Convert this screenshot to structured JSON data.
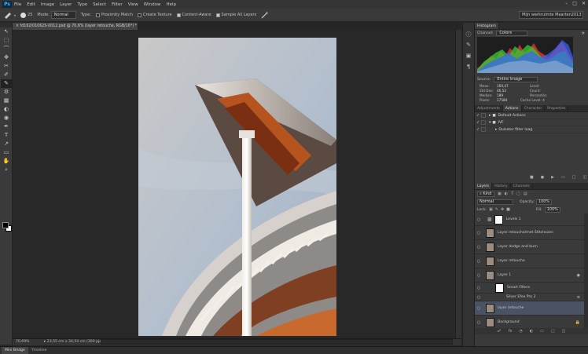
{
  "app": {
    "logo": "Ps"
  },
  "menu": [
    "File",
    "Edit",
    "Image",
    "Layer",
    "Type",
    "Select",
    "Filter",
    "View",
    "Window",
    "Help"
  ],
  "window_controls": [
    "–",
    "□",
    "✕"
  ],
  "options_bar": {
    "brush_size": "25",
    "mode_label": "Mode:",
    "mode_value": "Normal",
    "type_label": "Type:",
    "proximity_match": "Proximity Match",
    "create_texture": "Create Texture",
    "content_aware": "Content-Aware",
    "sample_all_layers": "Sample All Layers",
    "workspace": "Mijn werkruimte Maarten2013"
  },
  "document": {
    "tab_title": "× fd162/01062S-0012.psd @ 70,6% (layer retouche, RGB/16*) *",
    "zoom": "70,69%",
    "doc_info": "▸ 23,55 cm x 34,54 cm (300 ppi)"
  },
  "bottom_tabs": [
    "Mini Bridge",
    "Timeline"
  ],
  "histogram": {
    "tab": "Histogram",
    "channel_label": "Channel:",
    "channel_value": "Colors",
    "source_label": "Source:",
    "source_value": "Entire Image",
    "stats": [
      {
        "k": "Mean:",
        "v": "160,47"
      },
      {
        "k": "Std Dev:",
        "v": "46,52"
      },
      {
        "k": "Median:",
        "v": "189"
      },
      {
        "k": "Pixels:",
        "v": "17584"
      }
    ],
    "stats_right": [
      "Level:",
      "Count:",
      "Percentile:",
      "Cache Level: 4"
    ]
  },
  "actions_panel": {
    "tabs": [
      "Adjustments",
      "Actions",
      "Character",
      "Properties"
    ],
    "active": "Actions",
    "rows": [
      "Default Actions",
      "IVF",
      "Duisater filter laag"
    ]
  },
  "layers_panel": {
    "tabs": [
      "Layers",
      "History",
      "Channels"
    ],
    "kind_value": "⌕ Kind",
    "blend_value": "Normal",
    "opacity_label": "Opacity:",
    "opacity_value": "100%",
    "lock_label": "Lock:",
    "fill_label": "Fill:",
    "fill_value": "100%",
    "layers": [
      "Levels 1",
      "Layer retouche/met Stitchsoen",
      "Layer dodge and burn",
      "Layer retouche",
      "Layer 1",
      "Smart Filters",
      "Silver Efex Pro 2",
      "layer retouche",
      "Background"
    ],
    "selected_index": 7
  },
  "tools": [
    "↖",
    "⬚",
    "⌒",
    "✥",
    "✂",
    "✐",
    "✎",
    "⚙",
    "▦",
    "◐",
    "◉",
    "✒",
    "T",
    "↗",
    "▭",
    "✋",
    "⌕"
  ],
  "colors": {
    "accent_blue": "#4a5363",
    "photo_sky": "#b9c4d2",
    "brick": "#b5541e"
  }
}
